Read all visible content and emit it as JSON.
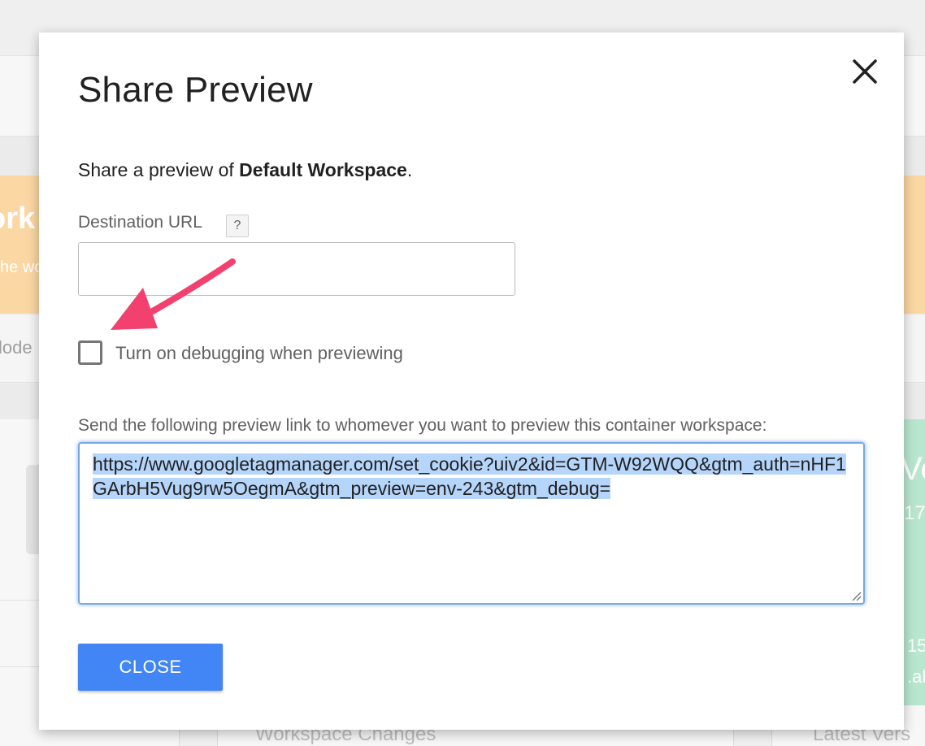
{
  "background": {
    "orange_title_fragment": "ork",
    "orange_subtitle_fragment": "he wo",
    "mode_fragment": "lode",
    "green_heading_fragment": "Ve",
    "green_number_fragment": "17",
    "green_number2_fragment": "15",
    "green_text_fragment": ".ah",
    "workspace_changes": "Workspace Changes",
    "latest_version": "Latest Vers"
  },
  "dialog": {
    "title": "Share Preview",
    "close_icon": "close-icon",
    "description_prefix": "Share a preview of ",
    "workspace_name": "Default Workspace",
    "description_suffix": ".",
    "destination_label": "Destination URL",
    "help_badge": "?",
    "destination_value": "",
    "debug_label": "Turn on debugging when previewing",
    "debug_checked": false,
    "send_label": "Send the following preview link to whomever you want to preview this container workspace:",
    "preview_link": "https://www.googletagmanager.com/set_cookie?uiv2&id=GTM-W92WQQ&gtm_auth=nHF1GArbH5Vug9rw5OegmA&gtm_preview=env-243&gtm_debug=",
    "close_button": "CLOSE"
  },
  "colors": {
    "primary_button": "#4285f4",
    "annotation_arrow": "#f2416f",
    "selection_highlight": "#b5d5fb",
    "background_orange": "#fbd7a3",
    "background_green": "#b9e6cf"
  }
}
